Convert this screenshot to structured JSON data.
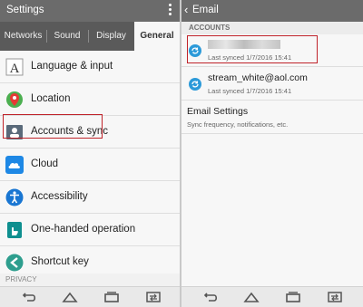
{
  "left": {
    "title": "Settings",
    "tabs": [
      {
        "label": "Networks",
        "active": false
      },
      {
        "label": "Sound",
        "active": false
      },
      {
        "label": "Display",
        "active": false
      },
      {
        "label": "General",
        "active": true
      }
    ],
    "items": [
      {
        "label": "Language & input",
        "icon": "language-icon"
      },
      {
        "label": "Location",
        "icon": "location-pin-icon"
      },
      {
        "label": "Accounts & sync",
        "icon": "accounts-icon",
        "highlighted": true
      },
      {
        "label": "Cloud",
        "icon": "cloud-icon"
      },
      {
        "label": "Accessibility",
        "icon": "accessibility-icon"
      },
      {
        "label": "One-handed operation",
        "icon": "one-handed-icon"
      },
      {
        "label": "Shortcut key",
        "icon": "shortcut-key-icon"
      }
    ],
    "section_privacy": "PRIVACY"
  },
  "right": {
    "title": "Email",
    "section_accounts": "ACCOUNTS",
    "accounts": [
      {
        "name": "",
        "name_obscured": true,
        "sync_text": "Last synced 1/7/2016 15:41",
        "highlighted": true
      },
      {
        "name": "stream_white@aol.com",
        "sync_text": "Last synced 1/7/2016 15:41"
      }
    ],
    "email_settings": {
      "label": "Email Settings",
      "description": "Sync frequency, notifications, etc."
    }
  },
  "colors": {
    "appbar": "#6b6b6b",
    "tabbar": "#5a5a5a",
    "highlight": "#c0232a",
    "sync_blue": "#2c9ad9"
  }
}
